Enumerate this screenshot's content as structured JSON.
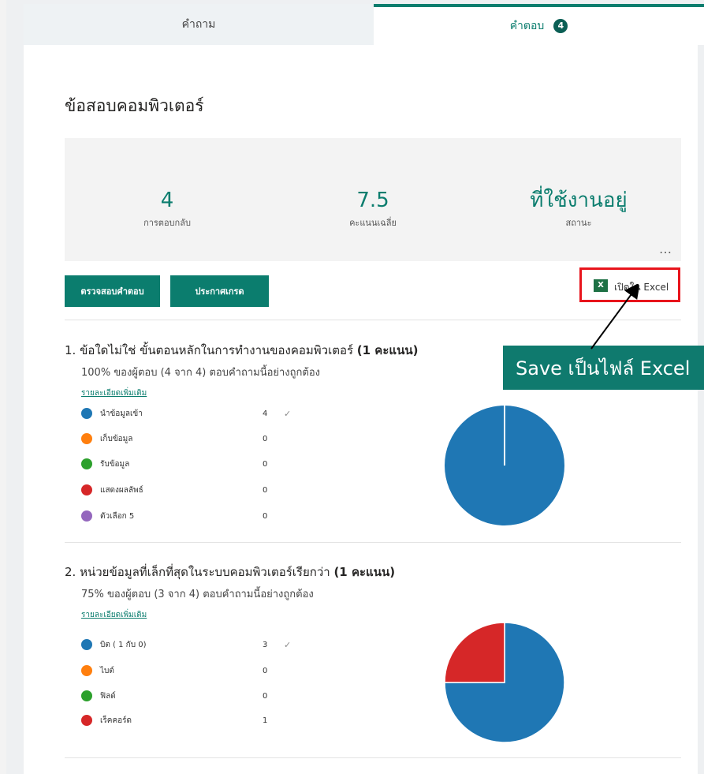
{
  "tabs": {
    "questions_label": "คำถาม",
    "responses_label": "คำตอบ",
    "responses_badge": "4"
  },
  "form": {
    "title": "ข้อสอบคอมพิวเตอร์"
  },
  "summary": {
    "responses_value": "4",
    "responses_label": "การตอบกลับ",
    "average_value": "7.5",
    "average_label": "คะแนนเฉลี่ย",
    "status_value": "ที่ใช้งานอยู่",
    "status_label": "สถานะ",
    "more_icon": "…"
  },
  "actions": {
    "review_label": "ตรวจสอบคำตอบ",
    "post_scores_label": "ประกาศเกรด",
    "excel_icon": "excel-icon",
    "excel_icon_text": "X",
    "excel_label": "เปิดใน Excel"
  },
  "callout": {
    "text": "Save เป็นไฟล์ Excel"
  },
  "questions": [
    {
      "number": "1.",
      "title": "ข้อใดไม่ใช่ ขั้นตอนหลักในการทำงานของคอมพิวเตอร์",
      "points": "(1 คะแนน)",
      "summary": "100% ของผู้ตอบ (4 จาก 4) ตอบคำถามนี้อย่างถูกต้อง",
      "details_link": "รายละเอียดเพิ่มเติม",
      "options": [
        {
          "label": "นำข้อมูลเข้า",
          "count": "4",
          "correct": "✓",
          "color": "#1f77b4"
        },
        {
          "label": "เก็บข้อมูล",
          "count": "0",
          "correct": "",
          "color": "#ff7f0e"
        },
        {
          "label": "รับข้อมูล",
          "count": "0",
          "correct": "",
          "color": "#2ca02c"
        },
        {
          "label": "แสดงผลลัพธ์",
          "count": "0",
          "correct": "",
          "color": "#d62728"
        },
        {
          "label": "ตัวเลือก 5",
          "count": "0",
          "correct": "",
          "color": "#9467bd"
        }
      ]
    },
    {
      "number": "2.",
      "title": "หน่วยข้อมูลที่เล็กที่สุดในระบบคอมพิวเตอร์เรียกว่า",
      "points": "(1 คะแนน)",
      "summary": "75% ของผู้ตอบ (3 จาก 4) ตอบคำถามนี้อย่างถูกต้อง",
      "details_link": "รายละเอียดเพิ่มเติม",
      "options": [
        {
          "label": "บิต ( 1 กับ 0)",
          "count": "3",
          "correct": "✓",
          "color": "#1f77b4"
        },
        {
          "label": "ไบต์",
          "count": "0",
          "correct": "",
          "color": "#ff7f0e"
        },
        {
          "label": "ฟิลด์",
          "count": "0",
          "correct": "",
          "color": "#2ca02c"
        },
        {
          "label": "เร็คคอร์ด",
          "count": "1",
          "correct": "",
          "color": "#d62728"
        }
      ]
    }
  ],
  "chart_data": [
    {
      "type": "pie",
      "categories": [
        "นำข้อมูลเข้า",
        "เก็บข้อมูล",
        "รับข้อมูล",
        "แสดงผลลัพธ์",
        "ตัวเลือก 5"
      ],
      "values": [
        4,
        0,
        0,
        0,
        0
      ],
      "colors": [
        "#1f77b4",
        "#ff7f0e",
        "#2ca02c",
        "#d62728",
        "#9467bd"
      ]
    },
    {
      "type": "pie",
      "categories": [
        "บิต ( 1 กับ 0)",
        "ไบต์",
        "ฟิลด์",
        "เร็คคอร์ด"
      ],
      "values": [
        3,
        0,
        0,
        1
      ],
      "colors": [
        "#1f77b4",
        "#ff7f0e",
        "#2ca02c",
        "#d62728"
      ]
    }
  ]
}
